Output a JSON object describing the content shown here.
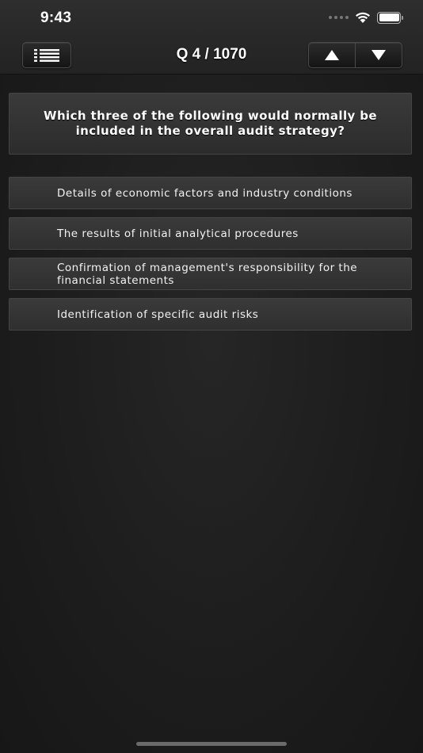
{
  "status_bar": {
    "time": "9:43"
  },
  "header": {
    "counter": "Q 4 / 1070",
    "menu_icon": "list-icon",
    "prev_icon": "triangle-up-icon",
    "next_icon": "triangle-down-icon"
  },
  "question": {
    "text": "Which three of the following would normally be included in the overall audit strategy?"
  },
  "answers": [
    {
      "text": "Details of economic factors and industry conditions"
    },
    {
      "text": "The results of initial analytical procedures"
    },
    {
      "text": "Confirmation of management's responsibility for the financial statements"
    },
    {
      "text": "Identification of specific audit risks"
    }
  ],
  "colors": {
    "background": "#1c1c1c",
    "header": "#2a2a2a",
    "card": "#343434",
    "text": "#ffffff"
  }
}
